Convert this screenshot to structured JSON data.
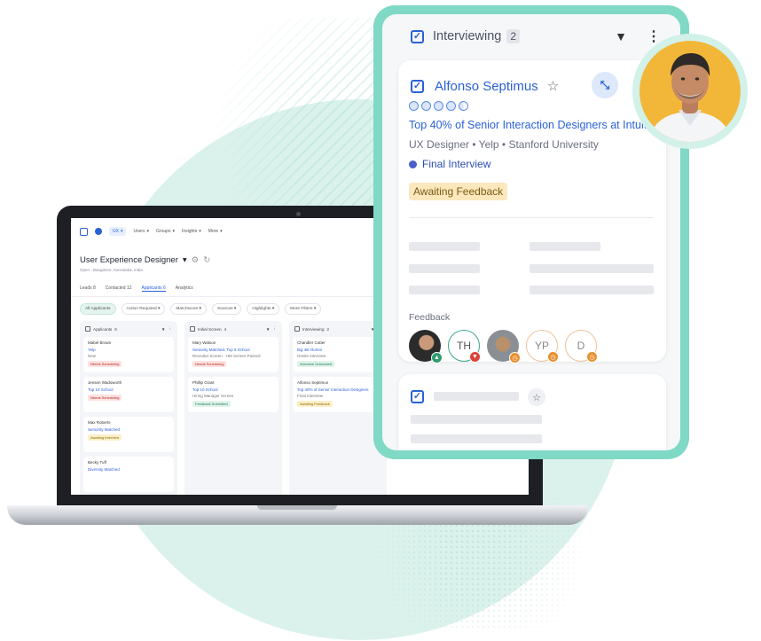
{
  "laptop_screen": {
    "nav": [
      "UX",
      "Users",
      "Groups",
      "Insights",
      "More"
    ],
    "job_title": "User Experience Designer",
    "job_subtitle": "Open · Bangalore, Karnataka, India",
    "tabs": [
      {
        "label": "Leads",
        "count": "8"
      },
      {
        "label": "Contacted",
        "count": "12"
      },
      {
        "label": "Applicants",
        "count": "6"
      },
      {
        "label": "Analytics",
        "count": ""
      }
    ],
    "filters": [
      "All Applicants",
      "Action Required",
      "Matchscore",
      "Sources",
      "Highlights",
      "More Filters"
    ],
    "columns": [
      {
        "title": "Applicants",
        "count": "6",
        "cards": [
          {
            "name": "Mabel Brown",
            "score": "Yelp",
            "meta": "New",
            "status": "Needs Scheduling",
            "status_type": "red"
          },
          {
            "name": "Jensen Wadsworth",
            "score": "Top 10 School",
            "meta": "",
            "status": "Needs Scheduling",
            "status_type": "red"
          },
          {
            "name": "Max Roberts",
            "score": "Seniority Matched",
            "meta": "",
            "status": "Awaiting Interview",
            "status_type": "yellow"
          },
          {
            "name": "Becky Tuff",
            "score": "Diversity Matched",
            "meta": "",
            "status": "",
            "status_type": ""
          }
        ]
      },
      {
        "title": "Initial Screen",
        "count": "4",
        "cards": [
          {
            "name": "Mary Watson",
            "score": "Seniority Matched, Top 5 School",
            "meta": "Recruiter Screen · HM Screen Passed",
            "status": "Needs Scheduling",
            "status_type": "red"
          },
          {
            "name": "Phillip Grant",
            "score": "Top 10 School",
            "meta": "Hiring Manager Screen",
            "status": "Feedback Submitted",
            "status_type": "green"
          }
        ]
      },
      {
        "title": "Interviewing",
        "count": "2",
        "cards": [
          {
            "name": "Chandler Cutter",
            "score": "Big 4B Alumni",
            "meta": "Onsite Interview",
            "status": "Interview Scheduled",
            "status_type": "green"
          },
          {
            "name": "Alfonso Septimus",
            "score": "Top 40% of Senior Interaction Designers",
            "meta": "Final Interview",
            "status": "Awaiting Feedback",
            "status_type": "yellow"
          }
        ]
      }
    ]
  },
  "panel": {
    "column_title": "Interviewing",
    "count": "2",
    "card": {
      "name": "Alfonso Septimus",
      "rating": 4.5,
      "highlight": "Top 40% of Senior Interaction Designers at Intuit",
      "meta": "UX Designer  •  Yelp  •  Stanford University",
      "stage": "Final Interview",
      "status": "Awaiting Feedback",
      "feedback_label": "Feedback",
      "feedback": [
        {
          "type": "photo",
          "initials": "",
          "vote": "up"
        },
        {
          "type": "initials",
          "initials": "TH",
          "vote": "down"
        },
        {
          "type": "photo",
          "initials": "",
          "vote": "pending"
        },
        {
          "type": "initials",
          "initials": "YP",
          "vote": "pending"
        },
        {
          "type": "initials",
          "initials": "D",
          "vote": "pending"
        }
      ]
    }
  },
  "colors": {
    "accent": "#2a62d6",
    "teal_frame": "#7fd9c4",
    "status_awaiting_bg": "#fde8be",
    "portrait_bg": "#f2b739"
  }
}
